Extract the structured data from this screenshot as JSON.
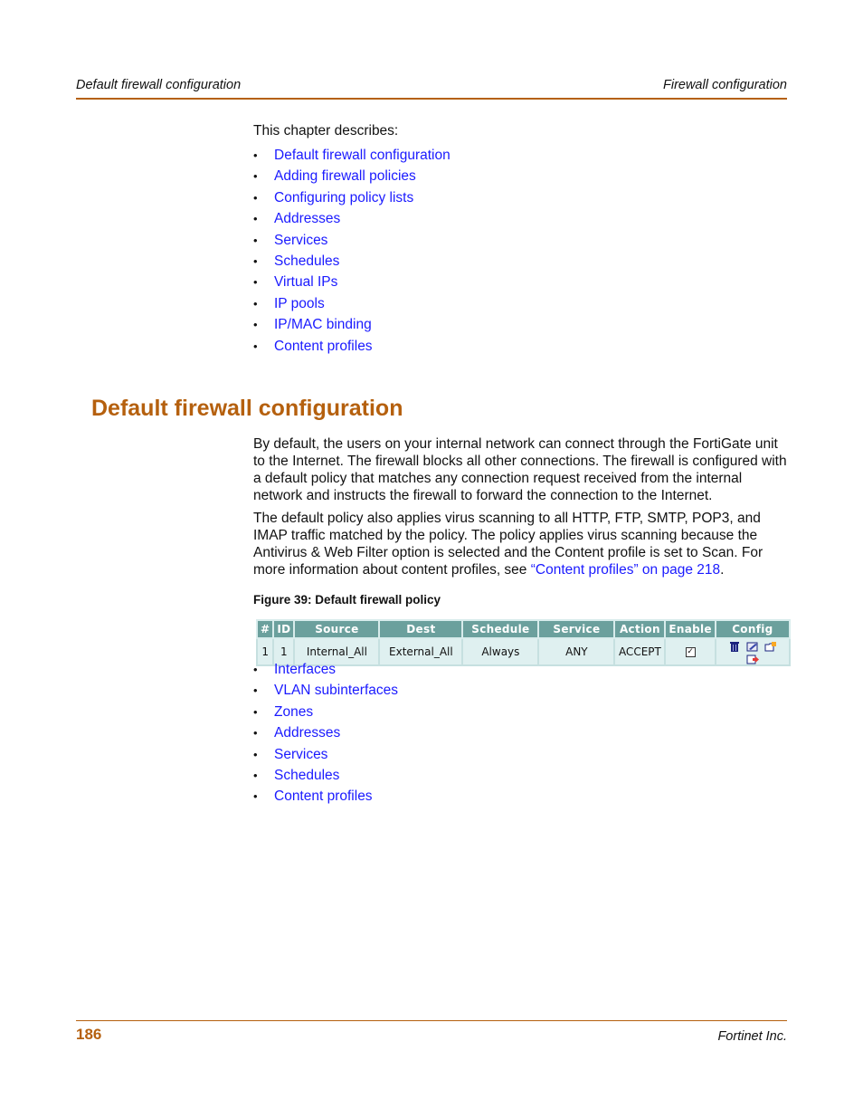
{
  "header": {
    "left": "Default firewall configuration",
    "right": "Firewall configuration"
  },
  "intro": "This chapter describes:",
  "toc": [
    "Default firewall configuration",
    "Adding firewall policies",
    "Configuring policy lists",
    "Addresses",
    "Services",
    "Schedules",
    "Virtual IPs",
    "IP pools",
    "IP/MAC binding",
    "Content profiles"
  ],
  "section": {
    "title": "Default firewall configuration",
    "para1": "By default, the users on your internal network can connect through the FortiGate unit to the Internet. The firewall blocks all other connections. The firewall is configured with a default policy that matches any connection request received from the internal network and instructs the firewall to forward the connection to the Internet.",
    "para2_text": "The default policy also applies virus scanning to all HTTP, FTP, SMTP, POP3, and IMAP traffic matched by the policy. The policy applies virus scanning because the Antivirus & Web Filter option is selected and the Content profile is set to Scan. For more information about content profiles, see ",
    "para2_link": "“Content profiles” on page 218",
    "para2_end": ".",
    "figure_caption": "Figure 39: Default firewall policy"
  },
  "policy_table": {
    "headers": [
      "#",
      "ID",
      "Source",
      "Dest",
      "Schedule",
      "Service",
      "Action",
      "Enable",
      "Config"
    ],
    "rows": [
      {
        "num": "1",
        "id": "1",
        "source": "Internal_All",
        "dest": "External_All",
        "schedule": "Always",
        "service": "ANY",
        "action": "ACCEPT",
        "enabled": true,
        "enable_glyph": "✓",
        "config_icons": [
          "trash-icon",
          "edit-icon",
          "insert-policy-icon",
          "move-icon"
        ]
      }
    ],
    "colors": {
      "header_bg": "#6ba09d",
      "row_bg": "#dff0f0"
    }
  },
  "related": [
    "Interfaces",
    "VLAN subinterfaces",
    "Zones",
    "Addresses",
    "Services",
    "Schedules",
    "Content profiles"
  ],
  "footer": {
    "page_number": "186",
    "company": "Fortinet Inc."
  },
  "colors": {
    "accent": "#b5600e",
    "link": "#1a1aff"
  }
}
